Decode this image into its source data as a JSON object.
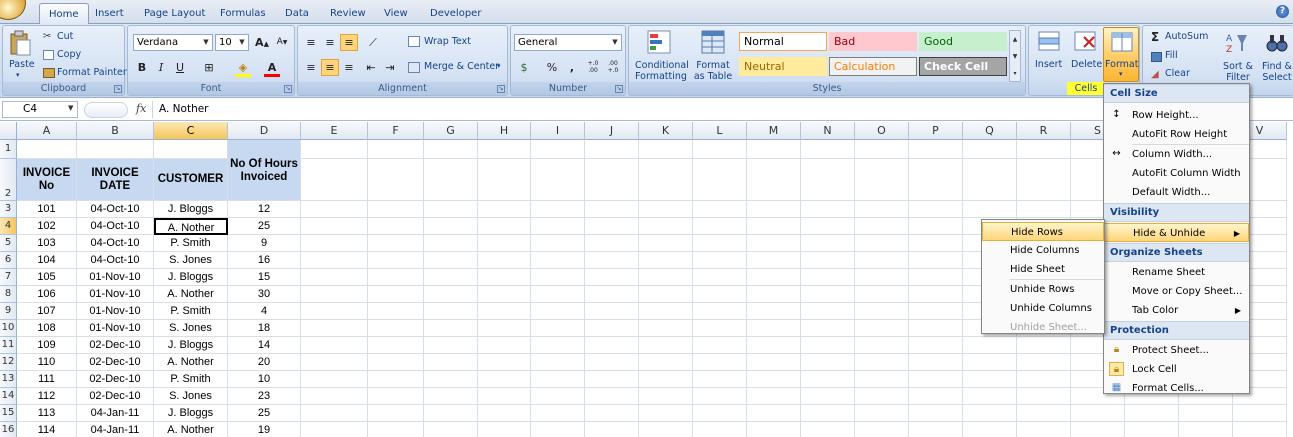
{
  "tabs": [
    "Home",
    "Insert",
    "Page Layout",
    "Formulas",
    "Data",
    "Review",
    "View",
    "Developer"
  ],
  "help_icon": "?",
  "clipboard": {
    "paste": "Paste",
    "cut": "Cut",
    "copy": "Copy",
    "format_painter": "Format Painter",
    "label": "Clipboard"
  },
  "font": {
    "name": "Verdana",
    "size": "10",
    "label": "Font",
    "bold": "B",
    "italic": "I",
    "underline": "U"
  },
  "alignment": {
    "wrap": "Wrap Text",
    "merge": "Merge & Center",
    "label": "Alignment"
  },
  "number": {
    "format": "General",
    "currency": "$",
    "percent": "%",
    "comma": ",",
    "inc_dec": "+.0 .00",
    "dec_dec": ".00 +.0",
    "label": "Number"
  },
  "styles": {
    "conditional": "Conditional Formatting",
    "format_table": "Format as Table",
    "label": "Styles",
    "cells": [
      {
        "name": "Normal",
        "bg": "#ffffff",
        "fg": "#000000",
        "border": "#f5a650"
      },
      {
        "name": "Bad",
        "bg": "#ffc7ce",
        "fg": "#9c0006",
        "border": "#ffc7ce"
      },
      {
        "name": "Good",
        "bg": "#c6efce",
        "fg": "#006100",
        "border": "#c6efce"
      },
      {
        "name": "Neutral",
        "bg": "#ffeb9c",
        "fg": "#9c6500",
        "border": "#ffeb9c"
      },
      {
        "name": "Calculation",
        "bg": "#f2f2f2",
        "fg": "#fa7d00",
        "border": "#7f7f7f"
      },
      {
        "name": "Check Cell",
        "bg": "#a5a5a5",
        "fg": "#ffffff",
        "border": "#3f3f3f"
      }
    ]
  },
  "cells_group": {
    "insert": "Insert",
    "delete": "Delete",
    "format": "Format",
    "label": "Cells"
  },
  "editing": {
    "autosum": "AutoSum",
    "fill": "Fill",
    "clear": "Clear",
    "sort": "Sort & Filter",
    "find": "Find & Select"
  },
  "formula_bar": {
    "name_box": "C4",
    "fx": "fx",
    "content": "A. Nother"
  },
  "columns": [
    "A",
    "B",
    "C",
    "D",
    "E",
    "F",
    "G",
    "H",
    "I",
    "J",
    "K",
    "L",
    "M",
    "N",
    "O",
    "P",
    "Q",
    "R",
    "S",
    "T",
    "U",
    "V"
  ],
  "table": {
    "headers": [
      "INVOICE No",
      "INVOICE DATE",
      "CUSTOMER",
      "No Of Hours Invoiced"
    ],
    "rows": [
      [
        "101",
        "04-Oct-10",
        "J. Bloggs",
        "12"
      ],
      [
        "102",
        "04-Oct-10",
        "A. Nother",
        "25"
      ],
      [
        "103",
        "04-Oct-10",
        "P. Smith",
        "9"
      ],
      [
        "104",
        "04-Oct-10",
        "S. Jones",
        "16"
      ],
      [
        "105",
        "01-Nov-10",
        "J. Bloggs",
        "15"
      ],
      [
        "106",
        "01-Nov-10",
        "A. Nother",
        "30"
      ],
      [
        "107",
        "01-Nov-10",
        "P. Smith",
        "4"
      ],
      [
        "108",
        "01-Nov-10",
        "S. Jones",
        "18"
      ],
      [
        "109",
        "02-Dec-10",
        "J. Bloggs",
        "14"
      ],
      [
        "110",
        "02-Dec-10",
        "A. Nother",
        "20"
      ],
      [
        "111",
        "02-Dec-10",
        "P. Smith",
        "10"
      ],
      [
        "112",
        "02-Dec-10",
        "S. Jones",
        "23"
      ],
      [
        "113",
        "04-Jan-11",
        "J. Bloggs",
        "25"
      ],
      [
        "114",
        "04-Jan-11",
        "A. Nother",
        "19"
      ]
    ]
  },
  "format_menu": {
    "sections": {
      "cell_size": "Cell Size",
      "visibility": "Visibility",
      "organize": "Organize Sheets",
      "protection": "Protection"
    },
    "items": {
      "row_height": "Row Height...",
      "autofit_row": "AutoFit Row Height",
      "column_width": "Column Width...",
      "autofit_col": "AutoFit Column Width",
      "default_width": "Default Width...",
      "hide_unhide": "Hide & Unhide",
      "rename": "Rename Sheet",
      "move_copy": "Move or Copy Sheet...",
      "tab_color": "Tab Color",
      "protect": "Protect Sheet...",
      "lock": "Lock Cell",
      "format_cells": "Format Cells..."
    }
  },
  "hide_menu": {
    "items": [
      "Hide Rows",
      "Hide Columns",
      "Hide Sheet",
      "Unhide Rows",
      "Unhide Columns",
      "Unhide Sheet..."
    ]
  }
}
